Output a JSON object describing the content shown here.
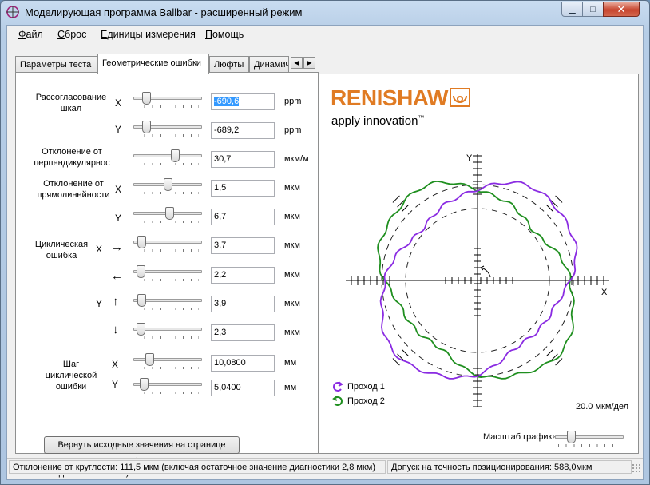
{
  "window": {
    "title": "Моделирующая программа Ballbar - расширенный режим"
  },
  "menu": [
    {
      "hot": "Ф",
      "rest": "айл"
    },
    {
      "hot": "С",
      "rest": "брос"
    },
    {
      "hot": "Е",
      "rest": "диницы измерения"
    },
    {
      "hot": "П",
      "rest": "омощь"
    }
  ],
  "tabs": [
    "Параметры теста",
    "Геометрические ошибки",
    "Люфты",
    "Динамич"
  ],
  "params": {
    "scale_mismatch": "Рассогласование шкал",
    "squareness": "Отклонение от перпендикулярнос",
    "straightness": "Отклонение от прямолинейности",
    "cyclic": "Циклическая ошибка",
    "cyclic_pitch": "Шаг циклической ошибки",
    "axis_x": "X",
    "axis_y": "Y",
    "arrow_right": "→",
    "arrow_left": "←",
    "arrow_up": "↑",
    "arrow_down": "↓"
  },
  "rows": [
    {
      "value": "-690,6",
      "unit": "ppm",
      "level": 0.15
    },
    {
      "value": "-689,2",
      "unit": "ppm",
      "level": 0.15
    },
    {
      "value": "30,7",
      "unit": "мкм/м",
      "level": 0.62
    },
    {
      "value": "1,5",
      "unit": "мкм",
      "level": 0.5
    },
    {
      "value": "6,7",
      "unit": "мкм",
      "level": 0.53
    },
    {
      "value": "3,7",
      "unit": "мкм",
      "level": 0.07
    },
    {
      "value": "2,2",
      "unit": "мкм",
      "level": 0.05
    },
    {
      "value": "3,9",
      "unit": "мкм",
      "level": 0.07
    },
    {
      "value": "2,3",
      "unit": "мкм",
      "level": 0.05
    },
    {
      "value": "10,0800",
      "unit": "мм",
      "level": 0.2
    },
    {
      "value": "5,0400",
      "unit": "мм",
      "level": 0.1
    }
  ],
  "reset_button": "Вернуть исходные значения на странице",
  "reset_hint": "Нажмите эту кнопку, чтобы установить ползунки на ноль (или вернуть в исходное положение).",
  "plot": {
    "logo": "RENISHAW",
    "tagline": "apply innovation",
    "tm": "™",
    "axis_x": "X",
    "axis_y": "Y",
    "legend": [
      "Проход 1",
      "Проход 2"
    ],
    "scale": "20.0 мкм/дел",
    "scale_slider_label": "Масштаб графика",
    "scale_slider_level": 0.2,
    "colors": {
      "run1": "#8a2be2",
      "run2": "#1f8f1f",
      "logo": "#e07b23"
    }
  },
  "status": {
    "roundness": "Отклонение от круглости: 111,5 мкм  (включая остаточное значение диагностики 2,8 мкм)",
    "accuracy": "Допуск на точность позиционирования: 588,0мкм"
  }
}
